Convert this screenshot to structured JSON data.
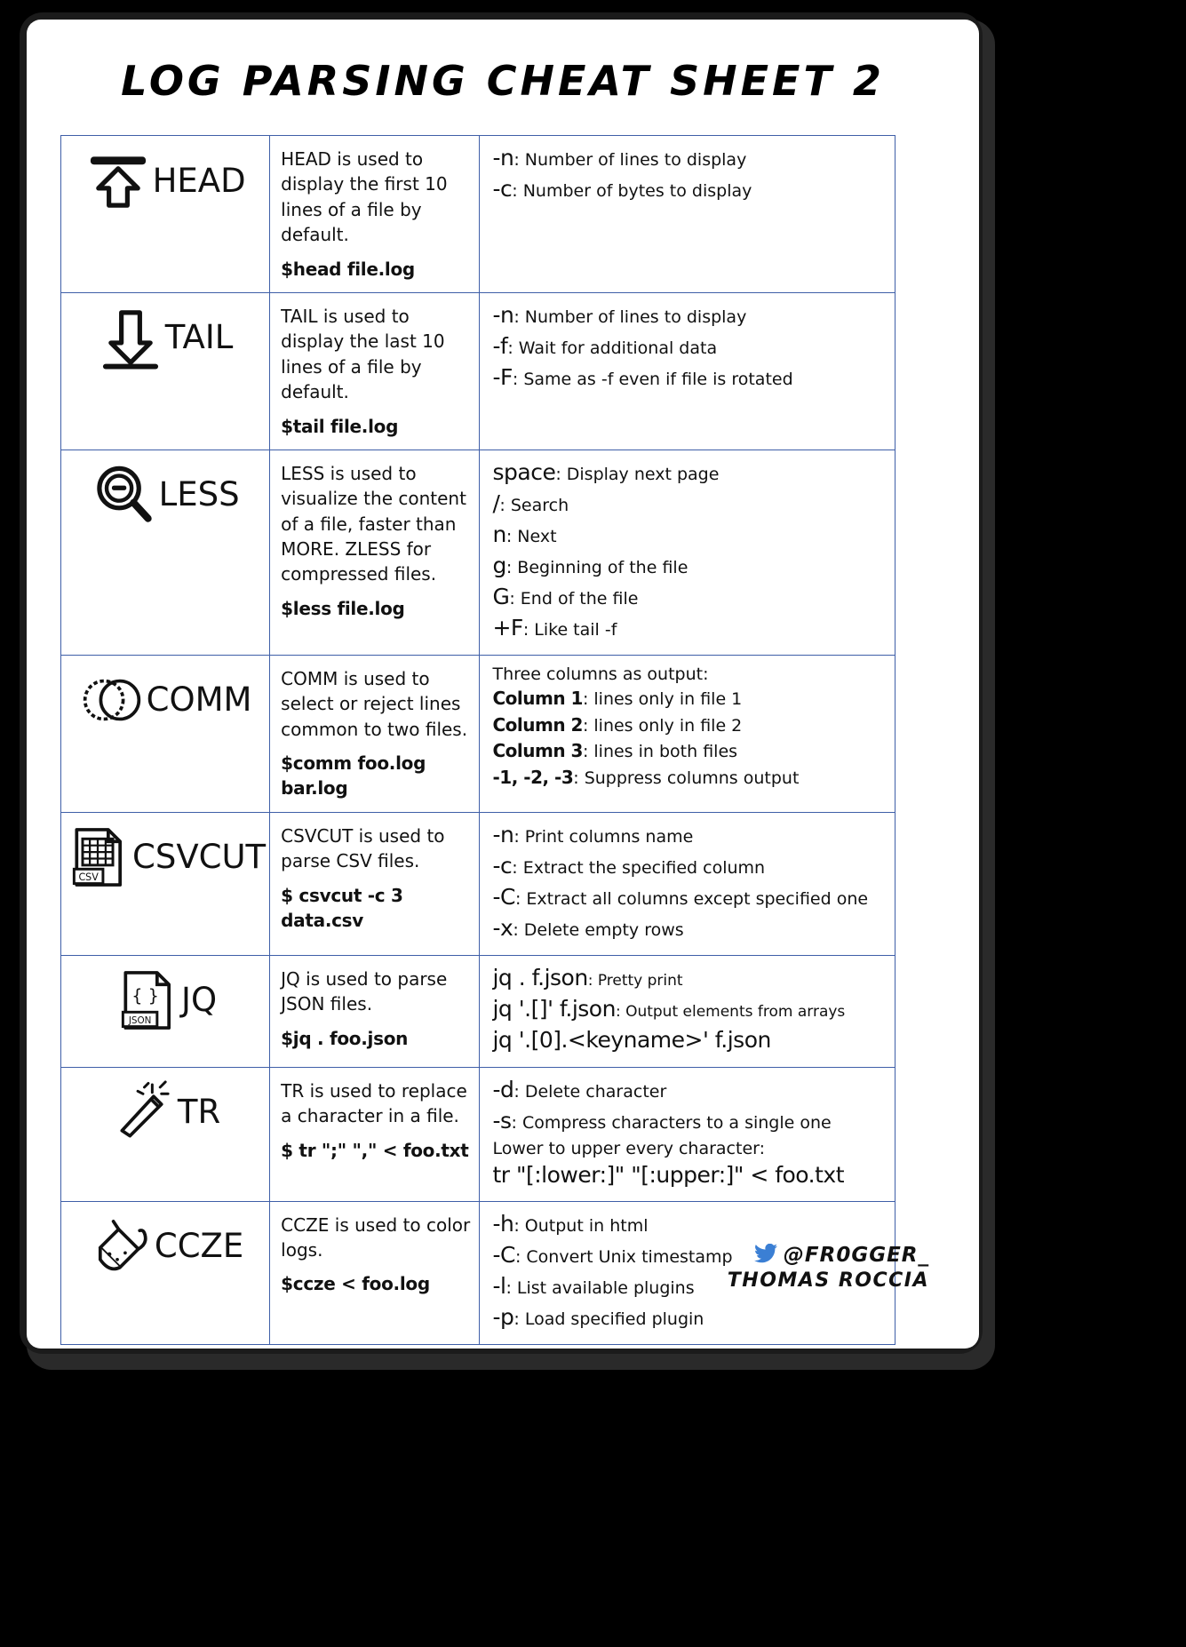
{
  "title": "Log Parsing Cheat Sheet 2",
  "accent_border_color": "#3f5fa8",
  "rows": [
    {
      "icon": "arrow-up-bar-icon",
      "name": "HEAD",
      "description": "HEAD is used to display the first 10 lines of a file by default.",
      "command": "$head file.log",
      "options": [
        {
          "key": "-n",
          "value": ": Number of lines to display"
        },
        {
          "key": "-c",
          "value": ": Number of bytes to display"
        }
      ]
    },
    {
      "icon": "arrow-down-bar-icon",
      "name": "TAIL",
      "description": "TAIL is used to display the last 10 lines of a file by default.",
      "command": "$tail file.log",
      "options": [
        {
          "key": "-n",
          "value": ": Number of lines to display"
        },
        {
          "key": "-f",
          "value": ": Wait for additional data"
        },
        {
          "key": "-F",
          "value": ": Same as -f even if file is rotated"
        }
      ]
    },
    {
      "icon": "magnifier-minus-icon",
      "name": "LESS",
      "description": "LESS is used to visualize the content of a file, faster than MORE. ZLESS for compressed files.",
      "command": "$less file.log",
      "options": [
        {
          "key": "space",
          "value": ": Display next page"
        },
        {
          "key": "/",
          "value": ": Search"
        },
        {
          "key": "n",
          "value": ": Next"
        },
        {
          "key": "g",
          "value": ": Beginning of the file"
        },
        {
          "key": "G",
          "value": ": End of the file"
        },
        {
          "key": "+F",
          "value": ": Like tail -f"
        }
      ]
    },
    {
      "icon": "venn-diagram-icon",
      "name": "COMM",
      "description": "COMM is used to select or reject lines common to two files.",
      "command": "$comm foo.log bar.log",
      "note": "Three columns as output:",
      "options": [
        {
          "key": "Column 1",
          "value": ": lines only in file 1",
          "bold": true
        },
        {
          "key": "Column 2",
          "value": ": lines only in file 2",
          "bold": true
        },
        {
          "key": "Column 3",
          "value": ": lines in both files",
          "bold": true
        },
        {
          "key": "-1, -2, -3",
          "value": ": Suppress columns output",
          "bold": true
        }
      ]
    },
    {
      "icon": "csv-file-icon",
      "name": "CSVCUT",
      "description": "CSVCUT is used to parse CSV files.",
      "command": "$ csvcut -c 3 data.csv",
      "options": [
        {
          "key": "-n",
          "value": ": Print columns name"
        },
        {
          "key": "-c",
          "value": ": Extract the specified column"
        },
        {
          "key": "-C",
          "value": ": Extract all columns except specified one"
        },
        {
          "key": "-x",
          "value": ": Delete empty rows"
        }
      ]
    },
    {
      "icon": "json-file-icon",
      "name": "JQ",
      "description": "JQ is used to parse JSON files.",
      "command": "$jq . foo.json",
      "options": [
        {
          "key": "jq . f.json",
          "value": ": Pretty print",
          "big": true
        },
        {
          "key": "jq '.[]' f.json",
          "value": ": Output elements from arrays",
          "big": true
        },
        {
          "key": "jq '.[0].<keyname>' f.json",
          "value": "",
          "big": true
        }
      ]
    },
    {
      "icon": "magic-wand-icon",
      "name": "TR",
      "description": "TR is used to replace a character in a file.",
      "command": "$ tr \";\" \",\" < foo.txt",
      "options": [
        {
          "key": "-d",
          "value": ": Delete character"
        },
        {
          "key": "-s",
          "value": ": Compress characters to a single one"
        }
      ],
      "note_after": "Lower to upper every character:",
      "big_after": "tr \"[:lower:]\" \"[:upper:]\" < foo.txt"
    },
    {
      "icon": "paint-bucket-icon",
      "name": "CCZE",
      "description": "CCZE is used to color logs.",
      "command": "$ccze < foo.log",
      "options": [
        {
          "key": "-h",
          "value": ": Output in html"
        },
        {
          "key": "-C",
          "value": ": Convert Unix timestamp"
        },
        {
          "key": "-l",
          "value": ":  List available plugins"
        },
        {
          "key": "-p",
          "value": ": Load specified plugin"
        }
      ]
    }
  ],
  "footer": {
    "twitter_icon": "twitter-bird-icon",
    "handle": "@Fr0gger_",
    "author": "Thomas Roccia"
  }
}
